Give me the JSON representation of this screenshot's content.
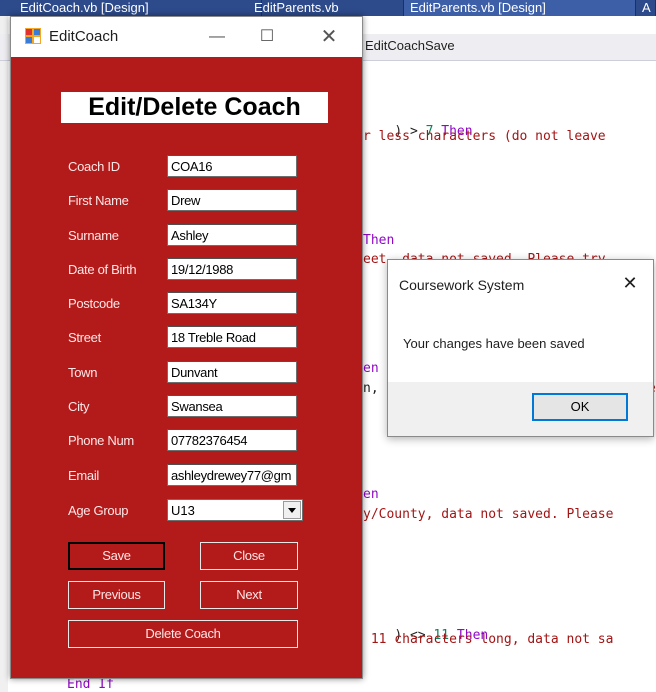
{
  "ide": {
    "tabs": [
      "EditCoach.vb [Design]",
      "EditParents.vb",
      "EditParents.vb [Design]",
      "A"
    ],
    "nav_method": "EditCoachSave",
    "code": {
      "line1_a": ") > ",
      "line1_num": "7",
      "line1_kw": " Then",
      "line2": "r less characters (do not leave",
      "line3_kw": "Then",
      "line4": "eet, data not saved. Please try",
      "line5": "en",
      "line6": "n,",
      "line6_tail": "e",
      "line7": "en",
      "line8": "y/County, data not saved. Please",
      "line9_a": ") <> ",
      "line9_num": "11",
      "line9_kw": " Then",
      "line10": " 11 characters long, data not sa",
      "line11": "End If"
    }
  },
  "form": {
    "window_title": "EditCoach",
    "heading": "Edit/Delete Coach",
    "fields": [
      {
        "label": "Coach ID",
        "value": "COA16"
      },
      {
        "label": "First Name",
        "value": "Drew"
      },
      {
        "label": "Surname",
        "value": "Ashley"
      },
      {
        "label": "Date of Birth",
        "value": "19/12/1988"
      },
      {
        "label": "Postcode",
        "value": "SA134Y"
      },
      {
        "label": "Street",
        "value": "18 Treble Road"
      },
      {
        "label": "Town",
        "value": "Dunvant"
      },
      {
        "label": "City",
        "value": "Swansea"
      },
      {
        "label": "Phone Num",
        "value": "07782376454"
      },
      {
        "label": "Email",
        "value": "ashleydrewey77@gm"
      }
    ],
    "age_group": {
      "label": "Age Group",
      "value": "U13"
    },
    "buttons": {
      "save": "Save",
      "close": "Close",
      "previous": "Previous",
      "next": "Next",
      "delete": "Delete Coach"
    },
    "colors": {
      "form_bg": "#b31b1b",
      "label_text": "#ffe6e6"
    }
  },
  "msgbox": {
    "title": "Coursework System",
    "message": "Your changes have been saved",
    "ok": "OK"
  }
}
